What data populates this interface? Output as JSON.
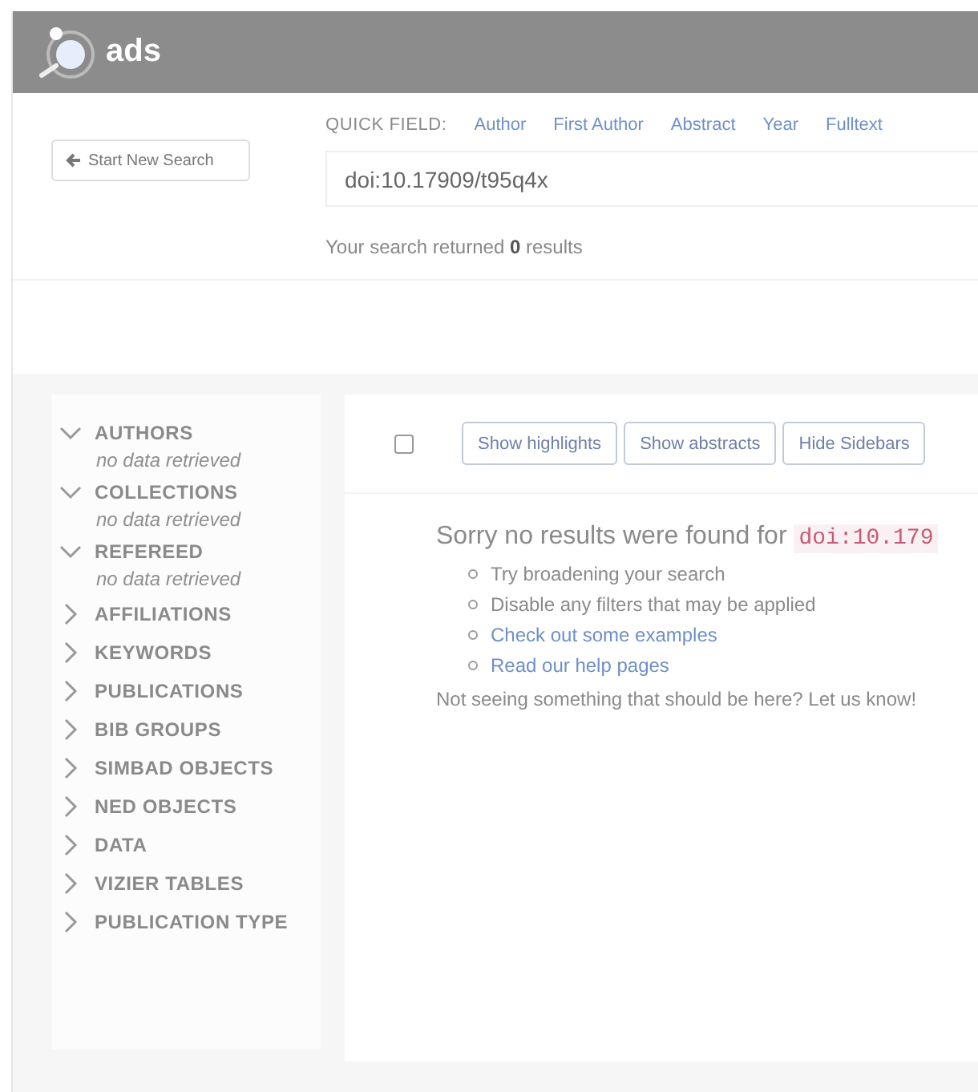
{
  "header": {
    "logo_text": "ads"
  },
  "search": {
    "quick_field_label": "QUICK FIELD:",
    "quick_fields": [
      "Author",
      "First Author",
      "Abstract",
      "Year",
      "Fulltext"
    ],
    "start_button": "Start New Search",
    "query": "doi:10.17909/t95q4x",
    "summary_before": "Your search returned",
    "count": "0",
    "summary_after": "results"
  },
  "sidebar": {
    "facets": [
      {
        "label": "AUTHORS",
        "expanded": true,
        "note": "no data retrieved"
      },
      {
        "label": "COLLECTIONS",
        "expanded": true,
        "note": "no data retrieved"
      },
      {
        "label": "REFEREED",
        "expanded": true,
        "note": "no data retrieved"
      },
      {
        "label": "AFFILIATIONS",
        "expanded": false
      },
      {
        "label": "KEYWORDS",
        "expanded": false
      },
      {
        "label": "PUBLICATIONS",
        "expanded": false
      },
      {
        "label": "BIB GROUPS",
        "expanded": false
      },
      {
        "label": "SIMBAD OBJECTS",
        "expanded": false
      },
      {
        "label": "NED OBJECTS",
        "expanded": false
      },
      {
        "label": "DATA",
        "expanded": false
      },
      {
        "label": "VIZIER TABLES",
        "expanded": false
      },
      {
        "label": "PUBLICATION TYPE",
        "expanded": false
      }
    ]
  },
  "results": {
    "select_all_checked": false,
    "toolbar_buttons": [
      "Show highlights",
      "Show abstracts",
      "Hide Sidebars"
    ],
    "message": "Sorry no results were found for",
    "message_query": "doi:10.179",
    "suggestions": [
      {
        "text": "Try broadening your search",
        "kind": "text"
      },
      {
        "text": "Disable any filters that may be applied",
        "kind": "text"
      },
      {
        "text": "Check out some examples",
        "kind": "link"
      },
      {
        "text": "Read our help pages",
        "kind": "link"
      }
    ],
    "feedback": "Not seeing something that should be here? Let us know!"
  }
}
